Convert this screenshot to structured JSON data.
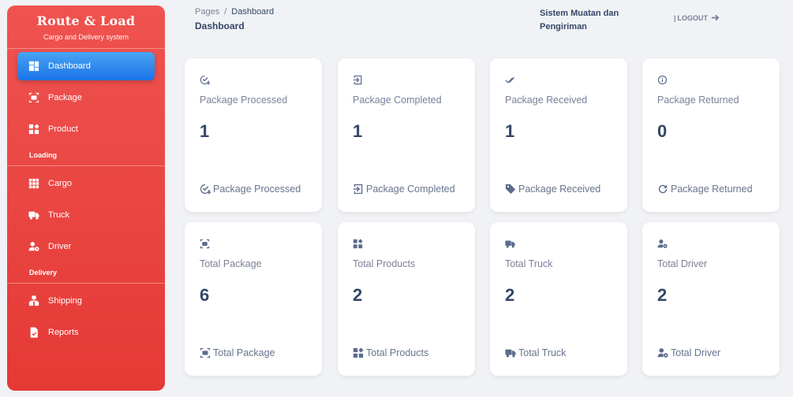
{
  "brand": {
    "title": "Route & Load",
    "subtitle": "Cargo and Delivery system"
  },
  "sidebar": {
    "items_main": [
      {
        "label": "Dashboard",
        "icon": "dashboard-icon"
      },
      {
        "label": "Package",
        "icon": "package-scan-icon"
      },
      {
        "label": "Product",
        "icon": "product-grid-icon"
      }
    ],
    "section_loading": "Loading",
    "items_loading": [
      {
        "label": "Cargo",
        "icon": "cargo-grid-icon"
      },
      {
        "label": "Truck",
        "icon": "truck-icon"
      },
      {
        "label": "Driver",
        "icon": "driver-icon"
      }
    ],
    "section_delivery": "Delivery",
    "items_delivery": [
      {
        "label": "Shipping",
        "icon": "shipping-icon"
      },
      {
        "label": "Reports",
        "icon": "report-icon"
      }
    ]
  },
  "breadcrumb": {
    "root": "Pages",
    "separator": "/",
    "current": "Dashboard"
  },
  "page_title": "Dashboard",
  "app_name_line1": "Sistem Muatan dan",
  "app_name_line2": "Pengiriman",
  "logout": {
    "prefix": "|",
    "label": "LOGOUT"
  },
  "cards": [
    {
      "label": "Package Processed",
      "value": "1",
      "footer": "Package Processed",
      "icon": "check-circle-icon"
    },
    {
      "label": "Package Completed",
      "value": "1",
      "footer": "Package Completed",
      "icon": "login-box-icon"
    },
    {
      "label": "Package Received",
      "value": "1",
      "footer": "Package Received",
      "icon": "double-check-icon"
    },
    {
      "label": "Package Returned",
      "value": "0",
      "footer": "Package Returned",
      "icon": "info-icon"
    },
    {
      "label": "Total Package",
      "value": "6",
      "footer": "Total Package",
      "icon": "package-scan-icon"
    },
    {
      "label": "Total Products",
      "value": "2",
      "footer": "Total Products",
      "icon": "product-grid-icon"
    },
    {
      "label": "Total Truck",
      "value": "2",
      "footer": "Total Truck",
      "icon": "truck-icon"
    },
    {
      "label": "Total Driver",
      "value": "2",
      "footer": "Total Driver",
      "icon": "driver-icon"
    }
  ]
}
